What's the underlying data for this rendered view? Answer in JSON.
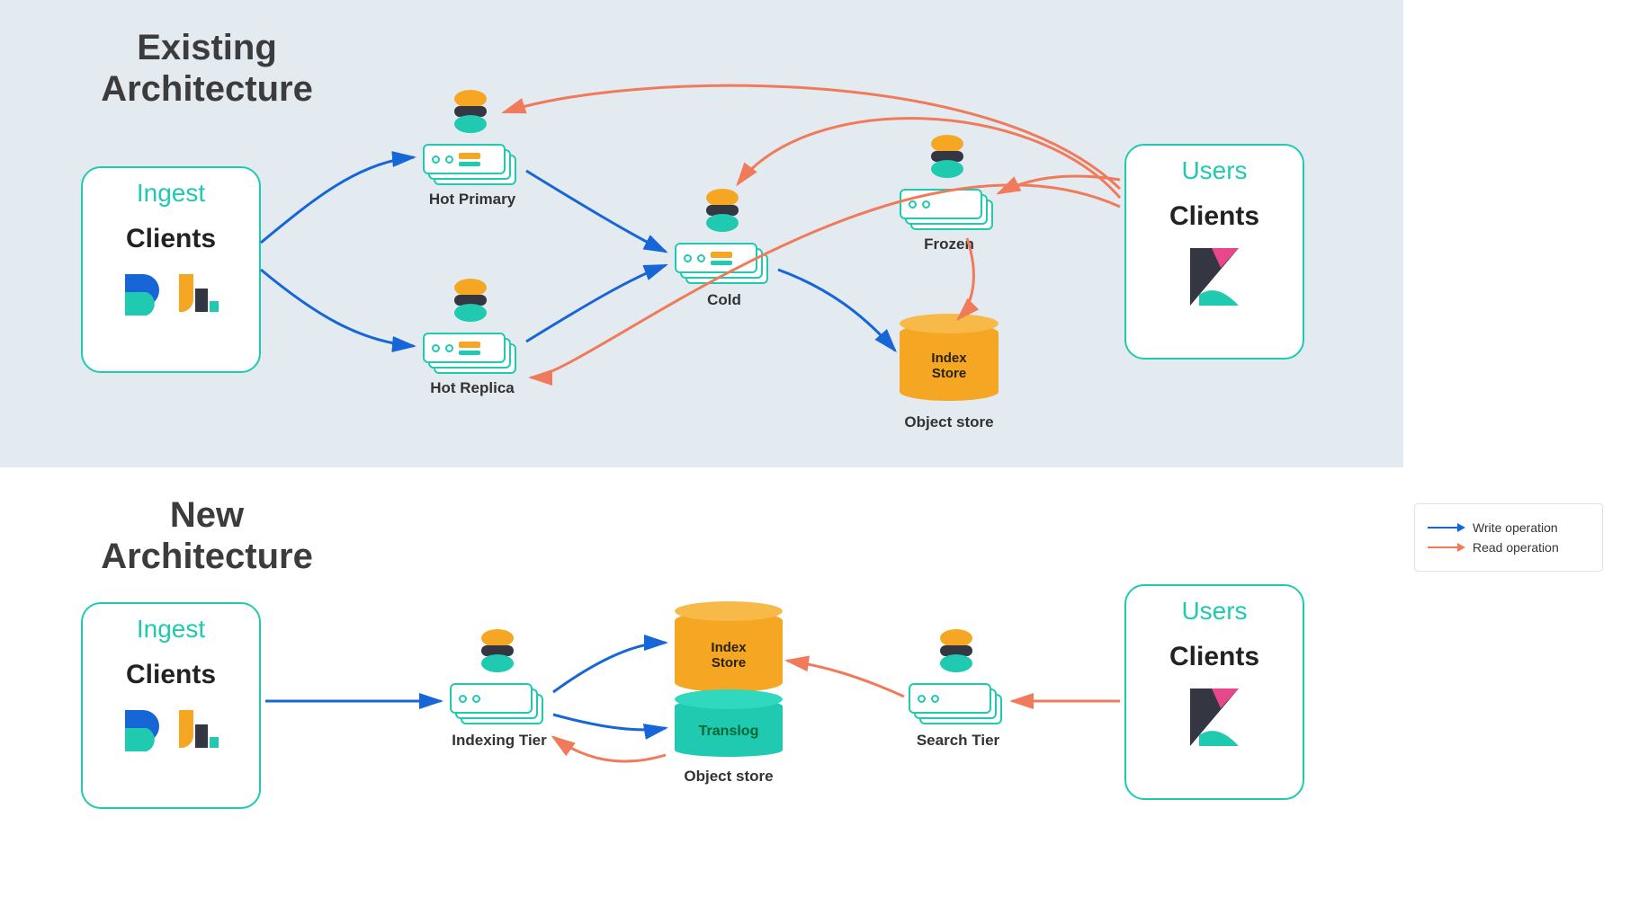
{
  "diagram": {
    "existing": {
      "title": "Existing\nArchitecture",
      "ingest": {
        "header": "Ingest",
        "label": "Clients"
      },
      "users": {
        "header": "Users",
        "label": "Clients"
      },
      "nodes": {
        "hot_primary": "Hot Primary",
        "hot_replica": "Hot Replica",
        "cold": "Cold",
        "frozen": "Frozen",
        "index_store": "Index\nStore",
        "object_store": "Object store"
      }
    },
    "new": {
      "title": "New\nArchitecture",
      "ingest": {
        "header": "Ingest",
        "label": "Clients"
      },
      "users": {
        "header": "Users",
        "label": "Clients"
      },
      "nodes": {
        "indexing_tier": "Indexing Tier",
        "search_tier": "Search Tier",
        "index_store": "Index\nStore",
        "translog": "Translog",
        "object_store": "Object store"
      }
    }
  },
  "legend": {
    "write": "Write operation",
    "read": "Read operation"
  },
  "colors": {
    "write": "#1766d8",
    "read": "#f07a5a",
    "teal": "#1fcab0",
    "yellow": "#f5a623",
    "dark": "#343741"
  }
}
